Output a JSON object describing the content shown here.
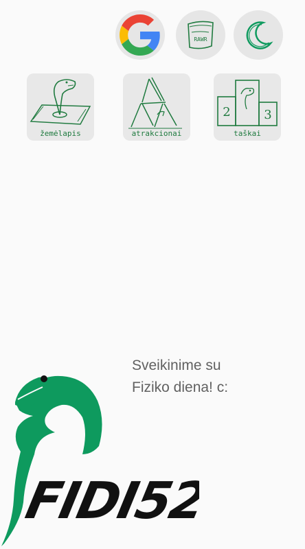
{
  "toolbar": {
    "google_icon": "google-icon",
    "rawr_label": "RAWR",
    "moon_icon": "moon-icon"
  },
  "tiles": [
    {
      "label": "žemėlapis",
      "icon": "map-dino-icon"
    },
    {
      "label": "atrakcionai",
      "icon": "card-house-icon"
    },
    {
      "label": "taškai",
      "icon": "podium-icon"
    }
  ],
  "greeting": {
    "line1": "Sveikinime su",
    "line2": "Fiziko diena! c:"
  },
  "logo": {
    "text": "FIDI52"
  },
  "colors": {
    "dino_green": "#0e9a5e",
    "sketch_green": "#1f7a3f",
    "background": "#fafafa",
    "tile_bg": "#e8e8e8",
    "logo_black": "#111111"
  }
}
